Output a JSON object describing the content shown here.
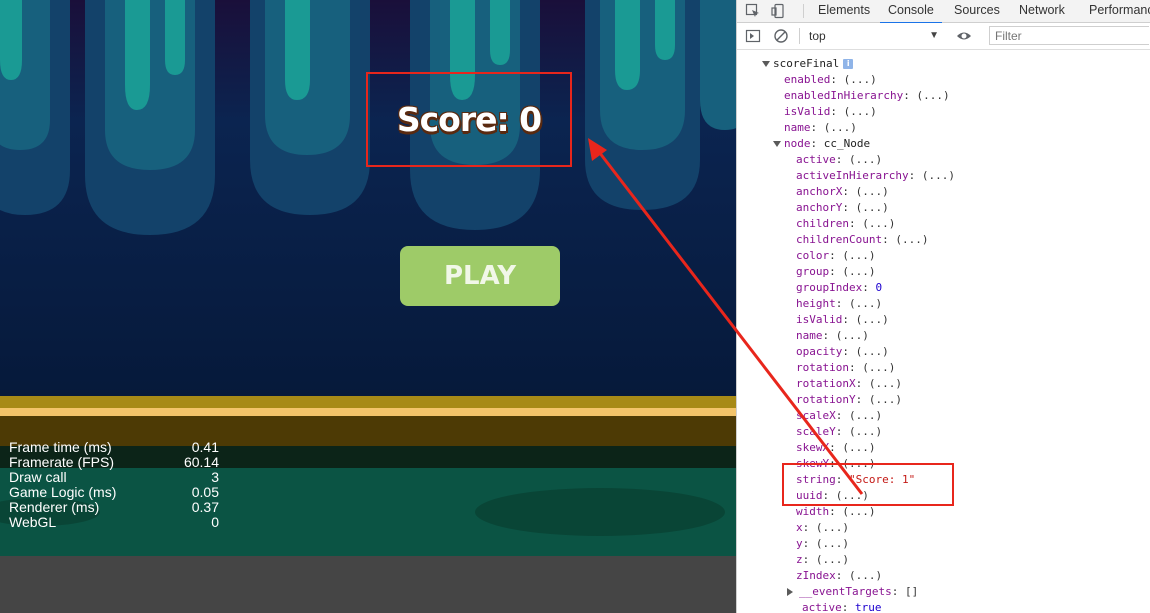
{
  "game": {
    "score_text": "Score: 0",
    "play_label": "PLAY",
    "stats": [
      {
        "label": "Frame time (ms)",
        "value": "0.41"
      },
      {
        "label": "Framerate (FPS)",
        "value": "60.14"
      },
      {
        "label": "Draw call",
        "value": "3"
      },
      {
        "label": "Game Logic (ms)",
        "value": "0.05"
      },
      {
        "label": "Renderer (ms)",
        "value": "0.37"
      },
      {
        "label": "WebGL",
        "value": "0"
      }
    ]
  },
  "devtools": {
    "tabs": [
      "Elements",
      "Console",
      "Sources",
      "Network",
      "Performance"
    ],
    "active_tab": "Console",
    "context": "top",
    "filter_placeholder": "Filter",
    "root": {
      "name": "scoreFinal",
      "info": "i"
    },
    "props": [
      {
        "key": "enabled",
        "value": "(...)"
      },
      {
        "key": "enabledInHierarchy",
        "value": "(...)"
      },
      {
        "key": "isValid",
        "value": "(...)"
      },
      {
        "key": "name",
        "value": "(...)"
      }
    ],
    "node": {
      "key": "node",
      "type": "cc_Node"
    },
    "node_props": [
      {
        "key": "active",
        "value": "(...)"
      },
      {
        "key": "activeInHierarchy",
        "value": "(...)"
      },
      {
        "key": "anchorX",
        "value": "(...)"
      },
      {
        "key": "anchorY",
        "value": "(...)"
      },
      {
        "key": "children",
        "value": "(...)"
      },
      {
        "key": "childrenCount",
        "value": "(...)"
      },
      {
        "key": "color",
        "value": "(...)"
      },
      {
        "key": "group",
        "value": "(...)"
      },
      {
        "key": "groupIndex",
        "value": "0",
        "kind": "num"
      },
      {
        "key": "height",
        "value": "(...)"
      },
      {
        "key": "isValid",
        "value": "(...)"
      },
      {
        "key": "name",
        "value": "(...)"
      },
      {
        "key": "opacity",
        "value": "(...)"
      },
      {
        "key": "rotation",
        "value": "(...)"
      },
      {
        "key": "rotationX",
        "value": "(...)"
      },
      {
        "key": "rotationY",
        "value": "(...)"
      },
      {
        "key": "scaleX",
        "value": "(...)"
      },
      {
        "key": "scaleY",
        "value": "(...)"
      },
      {
        "key": "skewX",
        "value": "(...)"
      },
      {
        "key": "skewY",
        "value": "(...)"
      }
    ],
    "after_props": [
      {
        "key": "string",
        "value": "\"Score: 1\"",
        "kind": "str"
      },
      {
        "key": "uuid",
        "value": "(...)"
      },
      {
        "key": "width",
        "value": "(...)"
      },
      {
        "key": "x",
        "value": "(...)"
      },
      {
        "key": "y",
        "value": "(...)"
      },
      {
        "key": "z",
        "value": "(...)"
      },
      {
        "key": "zIndex",
        "value": "(...)"
      }
    ],
    "event_targets": {
      "key": "__eventTargets",
      "value": "[]"
    },
    "tail": {
      "key": "active",
      "value": "true",
      "kind": "kw"
    }
  },
  "colors": {
    "annotation": "#e8261c",
    "game_bg": "#071b3e",
    "play_button": "#9ecb68",
    "teal": "#1a8f8c",
    "devtools_key": "#881391",
    "devtools_num": "#1c00cf",
    "devtools_str": "#c41a16"
  }
}
